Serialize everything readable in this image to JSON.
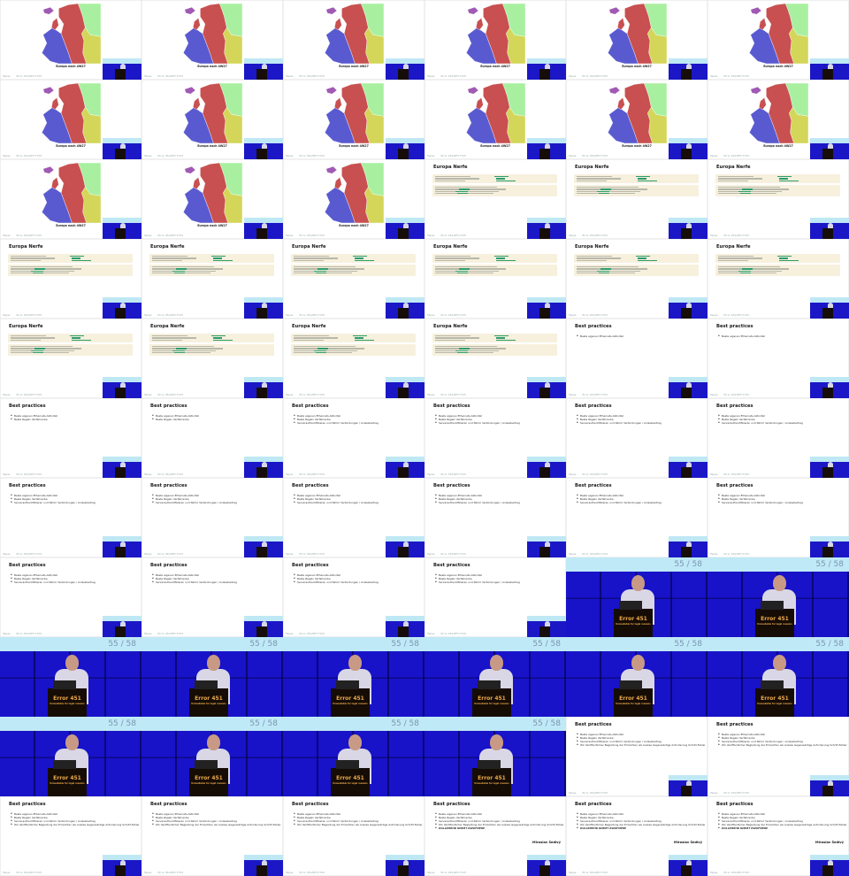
{
  "footer": {
    "left": "Tapes ",
    "right": "Error 451/RFC7725"
  },
  "map_caption": "Europa nach 4W27",
  "euro_title": "Europa Nerfe",
  "best_title": "Best practices",
  "bullets": [
    "Beste eigenen Ethernets-Aktivitat",
    "Beste Regeln Verfahrenbe",
    "Serverauthentifizieren und Nimm Verbindungen / Anlassbeitrag",
    "Wir Veröffentlicher Begleitung der Errlechten als Auslies Gegenwärtige Anforderung Schritt-Fehler",
    "DOLLEMEHR NIMMT RWOFMERE"
  ],
  "author": "Miroslav Šedivý",
  "brand": "Rsab.org",
  "video": {
    "slide_num": "55 / 58",
    "title": "Error 451",
    "subtitle": "Unavailable for legal reasons"
  },
  "colors": {
    "map_red": "#c85050",
    "map_blue": "#5a5ad0",
    "map_yellow": "#d4d65a",
    "map_green": "#a8f0a0",
    "map_purple": "#a05ab4",
    "stage_blue": "#1812c9",
    "band": "#bfe9f6"
  }
}
